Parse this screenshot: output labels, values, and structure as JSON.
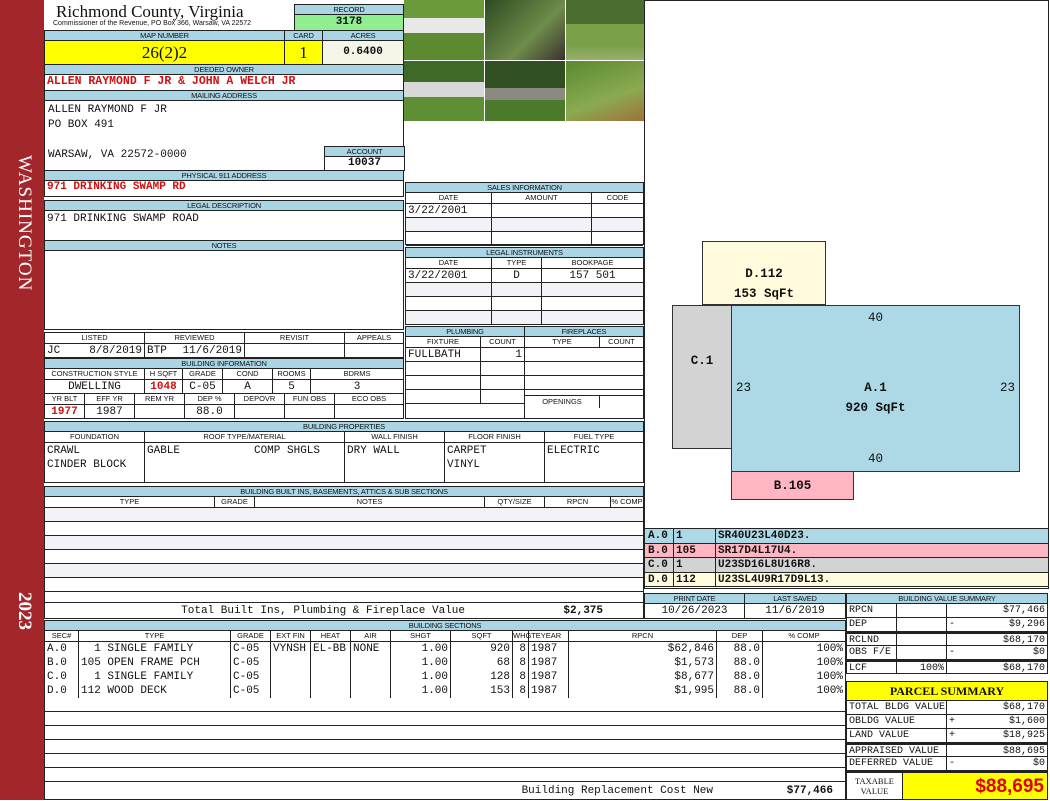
{
  "sidebar": {
    "top": "WASHINGTON",
    "bottom": "2023",
    "color": "#a3262a"
  },
  "header": {
    "title": "Richmond County, Virginia",
    "subtitle": "Commissioner of the Revenue, PO Box 366, Warsaw, VA 22572",
    "record_label": "RECORD",
    "record": "3178"
  },
  "parcel": {
    "map_label": "MAP NUMBER",
    "map": "26(2)2",
    "card_label": "CARD",
    "card": "1",
    "acres_label": "ACRES",
    "acres": "0.6400"
  },
  "owner": {
    "label": "DEEDED OWNER",
    "value": "ALLEN RAYMOND F JR & JOHN A WELCH JR"
  },
  "mailing": {
    "label": "MAILING ADDRESS",
    "line1": "ALLEN RAYMOND F JR",
    "line2": "PO BOX 491",
    "line3": "WARSAW, VA 22572-0000",
    "account_label": "ACCOUNT",
    "account": "10037"
  },
  "physical": {
    "label": "PHYSICAL 911 ADDRESS",
    "value": "971 DRINKING SWAMP RD"
  },
  "legal": {
    "label": "LEGAL DESCRIPTION",
    "value": "971 DRINKING SWAMP ROAD"
  },
  "notes": {
    "label": "NOTES"
  },
  "review": {
    "headers": [
      "LISTED",
      "REVIEWED",
      "REVISIT",
      "APPEALS"
    ],
    "listed_by": "JC",
    "listed_date": "8/8/2019",
    "reviewed_by": "BTP",
    "reviewed_date": "11/6/2019"
  },
  "building_info": {
    "label": "BUILDING INFORMATION",
    "h1": [
      "CONSTRUCTION STYLE",
      "H SQFT",
      "GRADE",
      "COND",
      "ROOMS",
      "BDRMS"
    ],
    "v1": [
      "DWELLING",
      "1048",
      "C-05",
      "A",
      "5",
      "3"
    ],
    "h2": [
      "YR BLT",
      "EFF YR",
      "REM YR",
      "DEP %",
      "DEPOVR",
      "FUN OBS",
      "ECO OBS"
    ],
    "v2": [
      "1977",
      "1987",
      "",
      "88.0",
      "",
      "",
      ""
    ]
  },
  "sales": {
    "label": "SALES INFORMATION",
    "headers": [
      "DATE",
      "AMOUNT",
      "CODE"
    ],
    "rows": [
      [
        "3/22/2001",
        "",
        ""
      ],
      [
        "",
        "",
        ""
      ],
      [
        "",
        "",
        ""
      ]
    ]
  },
  "instruments": {
    "label": "LEGAL INSTRUMENTS",
    "headers": [
      "DATE",
      "TYPE",
      "BOOKPAGE"
    ],
    "rows": [
      [
        "3/22/2001",
        "D",
        "157 501"
      ],
      [
        "",
        "",
        ""
      ],
      [
        "",
        "",
        ""
      ],
      [
        "",
        "",
        ""
      ]
    ]
  },
  "plumbing": {
    "label": "PLUMBING",
    "headers": [
      "FIXTURE",
      "COUNT"
    ],
    "rows": [
      [
        "FULLBATH",
        "1"
      ],
      [
        "",
        ""
      ],
      [
        "",
        ""
      ],
      [
        "",
        ""
      ]
    ]
  },
  "fireplaces": {
    "label": "FIREPLACES",
    "headers": [
      "TYPE",
      "COUNT"
    ],
    "openings": "OPENINGS"
  },
  "properties": {
    "label": "BUILDING PROPERTIES",
    "headers": [
      "FOUNDATION",
      "ROOF TYPE/MATERIAL",
      "WALL FINISH",
      "FLOOR FINISH",
      "FUEL TYPE"
    ],
    "foundation": [
      "CRAWL",
      "CINDER BLOCK"
    ],
    "roof_type": "GABLE",
    "roof_material": "COMP SHGLS",
    "wall": "DRY WALL",
    "floor": [
      "CARPET",
      "VINYL"
    ],
    "fuel": "ELECTRIC"
  },
  "builtins": {
    "label": "BUILDING BUILT INS, BASEMENTS, ATTICS & SUB SECTIONS",
    "headers": [
      "TYPE",
      "GRADE",
      "NOTES",
      "QTY/SIZE",
      "RPCN",
      "% COMP"
    ],
    "total_label": "Total Built Ins, Plumbing & Fireplace Value",
    "total": "$2,375"
  },
  "dates": {
    "print_label": "PRINT DATE",
    "print": "10/26/2023",
    "saved_label": "LAST SAVED",
    "saved": "11/6/2019"
  },
  "sections": {
    "label": "BUILDING SECTIONS",
    "headers": [
      "SEC#",
      "TYPE",
      "GRADE",
      "EXT FIN",
      "HEAT",
      "AIR",
      "SHGT",
      "SQFT",
      "WHGT",
      "EYEAR",
      "RPCN",
      "DEP",
      "% COMP"
    ],
    "rows": [
      [
        "A.0",
        "  1 SINGLE FAMILY",
        "C-05",
        "VYNSH",
        "EL-BB",
        "NONE",
        "1.00",
        "920",
        "8",
        "1987",
        "$62,846",
        "88.0",
        "100%"
      ],
      [
        "B.0",
        "105 OPEN FRAME PCH",
        "C-05",
        "",
        "",
        "",
        "1.00",
        "68",
        "8",
        "1987",
        "$1,573",
        "88.0",
        "100%"
      ],
      [
        "C.0",
        "  1 SINGLE FAMILY",
        "C-05",
        "",
        "",
        "",
        "1.00",
        "128",
        "8",
        "1987",
        "$8,677",
        "88.0",
        "100%"
      ],
      [
        "D.0",
        "112 WOOD DECK",
        "C-05",
        "",
        "",
        "",
        "1.00",
        "153",
        "8",
        "1987",
        "$1,995",
        "88.0",
        "100%"
      ]
    ],
    "total_label": "Building Replacement Cost New",
    "total": "$77,466"
  },
  "sketch": {
    "areas": [
      {
        "id": "D.112",
        "sqft": "153 SqFt",
        "color": "#fffbdc"
      },
      {
        "id": "C.1",
        "color": "#d3d3d3"
      },
      {
        "id": "A.1",
        "sqft": "920 SqFt",
        "color": "#add8e6"
      },
      {
        "id": "B.105",
        "color": "#ffb6c1"
      }
    ],
    "dims": {
      "top": "40",
      "bottom": "40",
      "left": "23",
      "right": "23"
    },
    "legend": [
      [
        "A.0",
        "1",
        "SR40U23L40D23.",
        "#add8e6"
      ],
      [
        "B.0",
        "105",
        "SR17D4L17U4.",
        "#ffb6c1"
      ],
      [
        "C.0",
        "1",
        "U23SD16L8U16R8.",
        "#d3d3d3"
      ],
      [
        "D.0",
        "112",
        "U23SL4U9R17D9L13.",
        "#fffbdc"
      ]
    ]
  },
  "value_summary": {
    "label": "BUILDING VALUE SUMMARY",
    "rows": [
      [
        "RPCN",
        "",
        "",
        "$77,466"
      ],
      [
        "DEP",
        "",
        "-",
        "$9,296"
      ],
      [
        "RCLND",
        "",
        "",
        "$68,170"
      ],
      [
        "OBS F/E",
        "",
        "-",
        "$0"
      ],
      [
        "LCF",
        "100%",
        "",
        "$68,170"
      ]
    ]
  },
  "parcel_summary": {
    "label": "PARCEL SUMMARY",
    "rows": [
      [
        "TOTAL BLDG VALUE",
        "",
        "$68,170"
      ],
      [
        "OBLDG VALUE",
        "+",
        "$1,600"
      ],
      [
        "LAND VALUE",
        "+",
        "$18,925"
      ],
      [
        "APPRAISED VALUE",
        "",
        "$88,695"
      ],
      [
        "DEFERRED VALUE",
        "-",
        "$0"
      ]
    ],
    "taxable_label": "TAXABLE VALUE",
    "taxable": "$88,695"
  }
}
